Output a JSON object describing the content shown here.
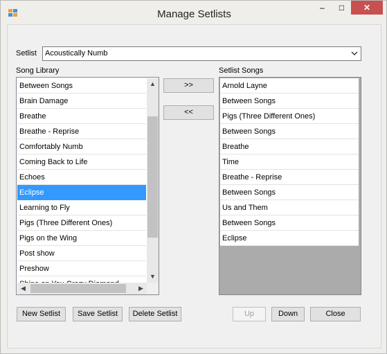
{
  "window": {
    "title": "Manage Setlists",
    "controls": {
      "minimize": "–",
      "maximize": "□",
      "close": "✕"
    }
  },
  "setlist": {
    "label": "Setlist",
    "selected": "Acoustically Numb"
  },
  "library": {
    "label": "Song Library",
    "items": [
      "Between Songs",
      "Brain Damage",
      "Breathe",
      "Breathe - Reprise",
      "Comfortably Numb",
      "Coming Back to Life",
      "Echoes",
      "Eclipse",
      "Learning to Fly",
      "Pigs (Three Different Ones)",
      "Pigs on the Wing",
      "Post show",
      "Preshow",
      "Shine on You Crazy Diamond"
    ],
    "selected_index": 7
  },
  "setlist_songs": {
    "label": "Setlist Songs",
    "items": [
      "Arnold Layne",
      "Between Songs",
      "Pigs (Three Different Ones)",
      "Between Songs",
      "Breathe",
      "Time",
      "Breathe - Reprise",
      "Between Songs",
      "Us and Them",
      "Between Songs",
      "Eclipse"
    ]
  },
  "transfer": {
    "add": ">>",
    "remove": "<<"
  },
  "buttons": {
    "new_setlist": "New Setlist",
    "save_setlist": "Save Setlist",
    "delete_setlist": "Delete Setlist",
    "up": "Up",
    "down": "Down",
    "close": "Close"
  },
  "icons": {
    "app": "app-icon",
    "dropdown": "chevron-down-icon",
    "scroll_up": "arrow-up-icon",
    "scroll_down": "arrow-down-icon",
    "scroll_left": "arrow-left-icon",
    "scroll_right": "arrow-right-icon"
  },
  "colors": {
    "selection": "#3399ff",
    "close_button": "#c75050",
    "empty_list_bg": "#ababab"
  }
}
